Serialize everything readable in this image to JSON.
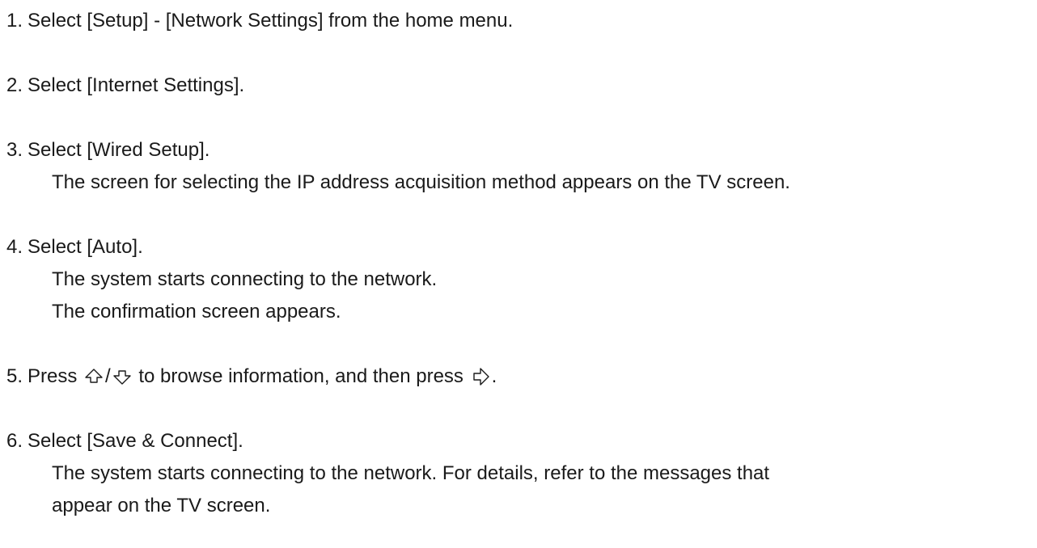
{
  "steps": [
    {
      "number": "1.",
      "text": "Select [Setup] - [Network Settings] from the home menu.",
      "details": []
    },
    {
      "number": "2.",
      "text": "Select [Internet Settings].",
      "details": []
    },
    {
      "number": "3.",
      "text": "Select [Wired Setup].",
      "details": [
        "The screen for selecting the IP address acquisition method appears on the TV screen."
      ]
    },
    {
      "number": "4.",
      "text": "Select [Auto].",
      "details": [
        "The system starts connecting to the network.",
        "The confirmation screen appears."
      ]
    },
    {
      "number": "5.",
      "text_before": "Press",
      "text_middle": "to browse information, and then press",
      "text_after": ".",
      "icons": [
        "up-arrow-icon",
        "down-arrow-icon",
        "right-arrow-icon"
      ],
      "separator": "/"
    },
    {
      "number": "6.",
      "text": "Select [Save & Connect].",
      "details": [
        "The system starts connecting to the network. For details, refer to the messages that",
        "appear on the TV screen."
      ]
    }
  ]
}
